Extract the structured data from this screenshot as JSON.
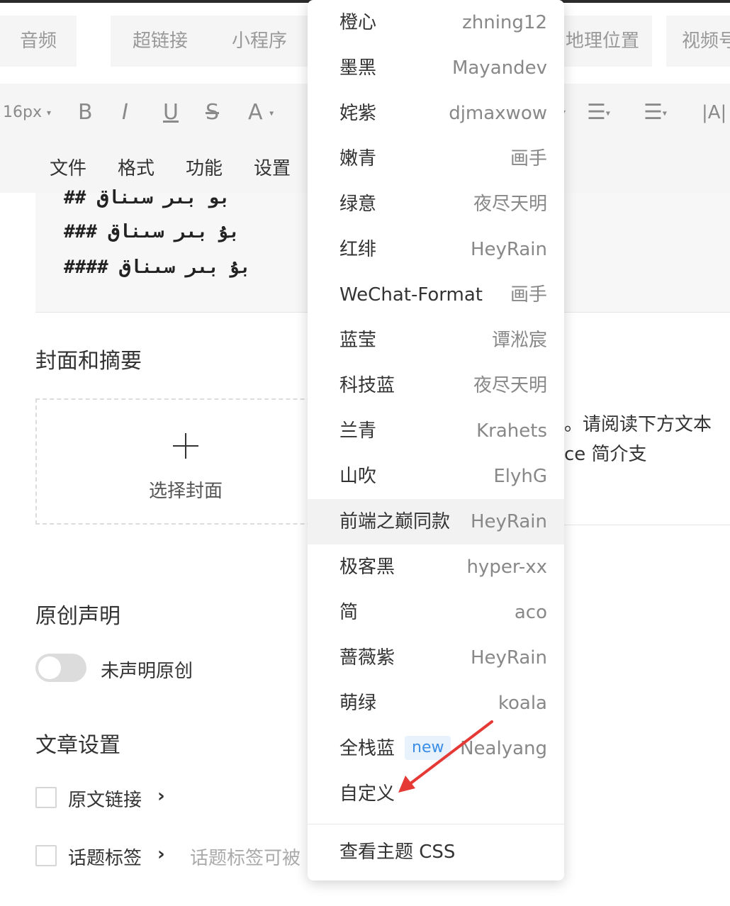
{
  "insert_tabs": [
    "音频",
    "超链接",
    "小程序",
    "地理位置",
    "视频号"
  ],
  "toolbar": {
    "font_size": "16px",
    "bold": "B",
    "italic": "I",
    "underline": "U",
    "strike": "S",
    "font_color": "A",
    "text_direction": "|A|"
  },
  "menubar": [
    "文件",
    "格式",
    "功能",
    "设置"
  ],
  "editor": {
    "lines": [
      "## بو بىر سىناق",
      "### بۇ بىر سىناق",
      "#### بۇ بىر سىناق"
    ]
  },
  "cover": {
    "title": "封面和摘要",
    "select_label": "选择封面",
    "summary_line1": "。请阅读下方文本",
    "summary_line2": "ce 简介支"
  },
  "original": {
    "title": "原创声明",
    "toggle_label": "未声明原创",
    "toggle_on": false
  },
  "article_settings": {
    "title": "文章设置",
    "source_link": "原文链接",
    "topic_tags": "话题标签",
    "topic_hint": "话题标签可被"
  },
  "theme_menu": {
    "items": [
      {
        "name": "橙心",
        "author": "zhning12"
      },
      {
        "name": "墨黑",
        "author": "Mayandev"
      },
      {
        "name": "姹紫",
        "author": "djmaxwow"
      },
      {
        "name": "嫩青",
        "author": "画手"
      },
      {
        "name": "绿意",
        "author": "夜尽天明"
      },
      {
        "name": "红绯",
        "author": "HeyRain"
      },
      {
        "name": "WeChat-Format",
        "author": "画手"
      },
      {
        "name": "蓝莹",
        "author": "谭淞宸"
      },
      {
        "name": "科技蓝",
        "author": "夜尽天明"
      },
      {
        "name": "兰青",
        "author": "Krahets"
      },
      {
        "name": "山吹",
        "author": "ElyhG"
      },
      {
        "name": "前端之巅同款",
        "author": "HeyRain"
      },
      {
        "name": "极客黑",
        "author": "hyper-xx"
      },
      {
        "name": "简",
        "author": "aco"
      },
      {
        "name": "蔷薇紫",
        "author": "HeyRain"
      },
      {
        "name": "萌绿",
        "author": "koala"
      },
      {
        "name": "全栈蓝",
        "author": "Nealyang",
        "badge": "new"
      },
      {
        "name": "自定义",
        "author": ""
      }
    ],
    "highlighted_index": 11,
    "footer": "查看主题 CSS"
  },
  "colors": {
    "arrow": "#e53935",
    "badge_text": "#3a8ee6"
  }
}
